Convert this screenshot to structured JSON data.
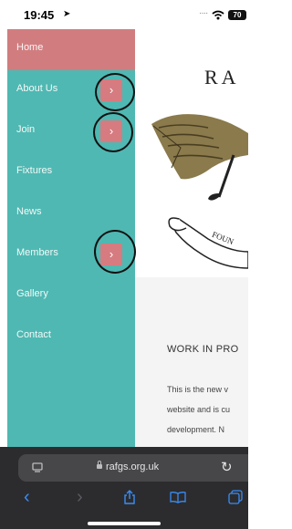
{
  "status_bar": {
    "time": "19:45",
    "battery": "70"
  },
  "menu": {
    "items": [
      {
        "label": "Home",
        "active": true,
        "has_submenu": false
      },
      {
        "label": "About Us",
        "active": false,
        "has_submenu": true
      },
      {
        "label": "Join",
        "active": false,
        "has_submenu": true
      },
      {
        "label": "Fixtures",
        "active": false,
        "has_submenu": false
      },
      {
        "label": "News",
        "active": false,
        "has_submenu": false
      },
      {
        "label": "Members",
        "active": false,
        "has_submenu": true
      },
      {
        "label": "Gallery",
        "active": false,
        "has_submenu": false
      },
      {
        "label": "Contact",
        "active": false,
        "has_submenu": false
      }
    ],
    "submenu_glyph": "›"
  },
  "page": {
    "logo_text": "RA",
    "ribbon_text": "FOUN",
    "heading": "WORK IN PRO",
    "paragraph_lines": [
      "This is the new v",
      "website and is cu",
      "development. N"
    ]
  },
  "browser": {
    "url": "rafgs.org.uk",
    "reload_icon": "↻",
    "back_icon": "‹",
    "forward_icon": "›"
  },
  "colors": {
    "menu_bg": "#4fb8b2",
    "menu_active": "#d17d7f",
    "submenu_button": "#d67b80",
    "annotation": "#111111"
  }
}
